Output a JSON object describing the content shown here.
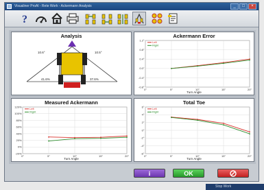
{
  "window": {
    "title": "Visualiner ProAl - Rete Work - Ackermann Analysis"
  },
  "toolbar": {
    "icons": [
      "help-icon",
      "gauge-icon",
      "home-icon",
      "printer-icon",
      "axle-front-icon",
      "axle-rear-icon",
      "car-lift-icon",
      "car-front-icon",
      "wheel-grid-icon",
      "report-icon"
    ]
  },
  "panels": {
    "analysis": {
      "title": "Analysis",
      "left_angle": "10.6°",
      "right_angle": "10.5°",
      "left_pct": "41.6%",
      "right_pct": "37.6%"
    },
    "ackermann_error": {
      "title": "Ackermann Error",
      "xlabel": "Turn Angle"
    },
    "measured_ackermann": {
      "title": "Measured Ackermann",
      "xlabel": "Turn Angle"
    },
    "total_toe": {
      "title": "Total Toe",
      "xlabel": "Turn Angle"
    }
  },
  "chart_data": [
    {
      "type": "line",
      "title": "Ackermann Error",
      "xlabel": "Turn Angle",
      "ylabel": "",
      "x": [
        0,
        5,
        10,
        15,
        20
      ],
      "xticks": [
        "0°",
        "5°",
        "10°",
        "15°",
        "20°"
      ],
      "yticks": [
        "1.2°",
        "0.8°",
        "0.4°",
        "0.0°",
        "-0.4°",
        "-0.8°"
      ],
      "ylim": [
        -0.8,
        1.2
      ],
      "series": [
        {
          "name": "Left",
          "color": "#d9302a",
          "values": [
            null,
            0.0,
            0.12,
            0.25,
            0.4
          ]
        },
        {
          "name": "Right",
          "color": "#2f8f2f",
          "values": [
            null,
            0.0,
            0.1,
            0.22,
            0.36
          ]
        }
      ]
    },
    {
      "type": "line",
      "title": "Measured Ackermann",
      "xlabel": "Turn Angle",
      "ylabel": "",
      "x": [
        0,
        5,
        10,
        15,
        20
      ],
      "xticks": [
        "0°",
        "5°",
        "10°",
        "15°",
        "20°"
      ],
      "yticks": [
        "120%",
        "100%",
        "80%",
        "60%",
        "40%",
        "20%",
        "0%",
        "-20%"
      ],
      "ylim": [
        -20,
        120
      ],
      "series": [
        {
          "name": "Left",
          "color": "#d9302a",
          "values": [
            null,
            30,
            28,
            29,
            33
          ]
        },
        {
          "name": "Right",
          "color": "#2f8f2f",
          "values": [
            null,
            18,
            25,
            26,
            29
          ]
        }
      ]
    },
    {
      "type": "line",
      "title": "Total Toe",
      "xlabel": "Turn Angle",
      "ylabel": "",
      "x": [
        0,
        5,
        10,
        15,
        20
      ],
      "xticks": [
        "0°",
        "5°",
        "10°",
        "15°",
        "20°"
      ],
      "yticks": [
        "6°",
        "4°",
        "2°",
        "0°",
        "-2°",
        "-4°",
        "-6°"
      ],
      "ylim": [
        -6,
        6
      ],
      "series": [
        {
          "name": "Left",
          "color": "#d9302a",
          "values": [
            null,
            3.4,
            2.8,
            1.8,
            -0.4
          ]
        },
        {
          "name": "Right",
          "color": "#2f8f2f",
          "values": [
            null,
            3.3,
            2.6,
            1.4,
            -0.9
          ]
        }
      ]
    }
  ],
  "buttons": {
    "ok_label": "OK"
  },
  "taskbar": {
    "text": "Stop Work"
  }
}
